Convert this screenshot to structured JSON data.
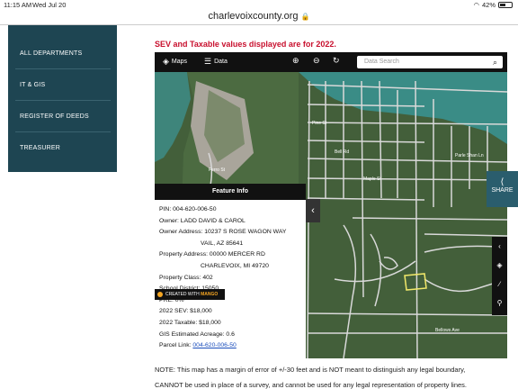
{
  "status": {
    "time": "11:15 AM",
    "date": "Wed Jul 20",
    "battery": "42%"
  },
  "browser": {
    "url": "charlevoixcounty.org"
  },
  "sidebar": {
    "items": [
      {
        "label": "ALL DEPARTMENTS"
      },
      {
        "label": "IT & GIS"
      },
      {
        "label": "REGISTER OF DEEDS"
      },
      {
        "label": "TREASURER"
      }
    ]
  },
  "notice": "SEV and Taxable values displayed are for 2022.",
  "map": {
    "toolbar": {
      "maps_label": "Maps",
      "data_label": "Data",
      "search_placeholder": "Data Search"
    },
    "street_labels": [
      "Bell Rd",
      "Maple St",
      "Pine St",
      "Ferro St",
      "Parle Shan Ln",
      "Bellows Ave"
    ],
    "feature_info": {
      "title": "Feature Info",
      "pin": "PIN: 004-620-006-50",
      "owner": "Owner: LADD DAVID & CAROL",
      "owner_address": "Owner Address: 10237 S ROSE WAGON WAY",
      "owner_address_2": "VAIL, AZ 85641",
      "property_address": "Property Address: 00000 MERCER RD",
      "property_address_2": "CHARLEVOIX, MI 49720",
      "property_class": "Property Class: 402",
      "school_district": "School District: 15050",
      "pre": "PRE: 0%",
      "sev": "2022 SEV: $18,000",
      "taxable": "2022 Taxable: $18,000",
      "acreage": "GIS Estimated Acreage: 0.6",
      "parcel_link_label": "Parcel Link: ",
      "parcel_link": "004-620-006-50"
    },
    "mango_prefix": "CREATED WITH",
    "mango_brand": "MANGO",
    "share_label": "SHARE"
  },
  "footer": {
    "line1": "NOTE: This map has a margin of error of +/-30 feet and is NOT meant to distinguish any legal boundary,",
    "line2": "CANNOT be used in place of a survey, and cannot be used for any legal representation of property lines."
  }
}
